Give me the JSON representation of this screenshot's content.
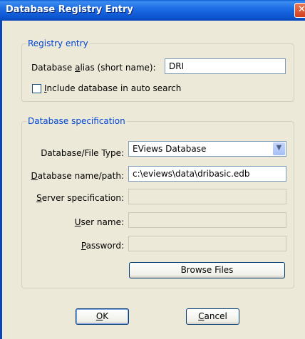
{
  "window": {
    "title": "Database Registry Entry"
  },
  "registry": {
    "legend": "Registry entry",
    "alias_label_pre": "Database ",
    "alias_label_ul": "a",
    "alias_label_post": "lias (short name):",
    "alias_value": "DRI",
    "autosearch_ul": "I",
    "autosearch_post": "nclude database in auto search",
    "autosearch_checked": false
  },
  "spec": {
    "legend": "Database specification",
    "type_label": "Database/File Type:",
    "type_value": "EViews Database",
    "path_label_ul": "D",
    "path_label_post": "atabase name/path:",
    "path_value": "c:\\eviews\\data\\dribasic.edb",
    "server_label_ul": "S",
    "server_label_post": "erver specification:",
    "user_label_ul": "U",
    "user_label_post": "ser name:",
    "password_label_ul": "P",
    "password_label_post": "assword:",
    "browse_label": "Browse Files"
  },
  "buttons": {
    "ok_ul": "O",
    "ok_post": "K",
    "cancel_ul": "C",
    "cancel_post": "ancel"
  },
  "colors": {
    "title_bar": "#0c54cf",
    "legend_text": "#0046d5",
    "dialog_bg": "#ece9d8"
  }
}
